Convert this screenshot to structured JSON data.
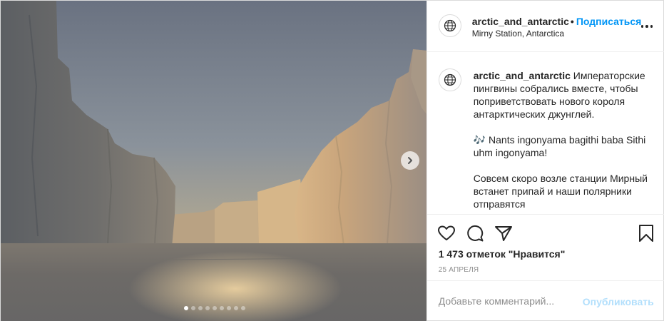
{
  "account": {
    "username": "arctic_and_antarctic",
    "separator": "•",
    "follow_label": "Подписаться",
    "location": "Mirny Station, Antarctica",
    "avatar_icon": "globe-icon"
  },
  "caption": {
    "username": "arctic_and_antarctic",
    "text": "Императорские пингвины собрались вместе, чтобы поприветствовать нового короля антарктических джунглей.\n\n🎶 Nants ingonyama bagithi baba Sithi uhm ingonyama!\n\nСовсем скоро возле станции Мирный встанет припай и наши полярники отправятся"
  },
  "media": {
    "carousel_total": 9,
    "carousel_current": 1,
    "next_icon": "chevron-right-icon"
  },
  "actions": {
    "icons": [
      "heart-icon",
      "comment-icon",
      "share-icon",
      "bookmark-icon"
    ]
  },
  "likes": {
    "text": "1 473 отметок \"Нравится\""
  },
  "date": "25 АПРЕЛЯ",
  "comment": {
    "placeholder": "Добавьте комментарий...",
    "publish_label": "Опубликовать"
  },
  "colors": {
    "link_blue": "#0095f6",
    "publish_disabled": "#b2dffc",
    "secondary_text": "#8e8e8e",
    "border": "#dbdbdb"
  }
}
